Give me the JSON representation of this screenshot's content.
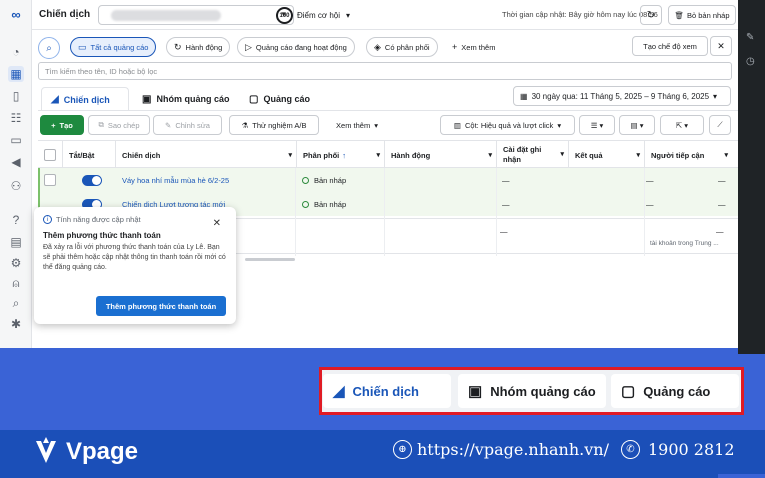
{
  "header": {
    "title": "Chiến dịch",
    "score_value": "100",
    "score_label": "Điểm cơ hội",
    "update_text": "Thời gian cập nhật: Bây giờ hôm nay lúc 08:56",
    "discard_label": "Bỏ bản nháp"
  },
  "filters": {
    "chips": [
      "Tất cả quảng cáo",
      "Hành động",
      "Quảng cáo đang hoạt động",
      "Có phân phối"
    ],
    "more_label": "Xem thêm",
    "create_view": "Tạo chế độ xem",
    "search_placeholder": "Tìm kiếm theo tên, ID hoặc bộ lọc"
  },
  "level_tabs": [
    "Chiến dịch",
    "Nhóm quảng cáo",
    "Quảng cáo"
  ],
  "date_range": "30 ngày qua: 11 Tháng 5, 2025 – 9 Tháng 6, 2025",
  "toolbar": {
    "create": "Tạo",
    "duplicate": "Sao chép",
    "edit": "Chỉnh sửa",
    "ab_test": "Thử nghiệm A/B",
    "more": "Xem thêm",
    "columns": "Cột: Hiệu quả và lượt click"
  },
  "table": {
    "columns": [
      "Tắt/Bật",
      "Chiến dịch",
      "Phân phối",
      "Hành động",
      "Cài đặt ghi nhận",
      "Kết quả",
      "Người tiếp cận"
    ],
    "rows": [
      {
        "name": "Váy hoa nhí mẫu mùa hè 6/2-25",
        "delivery": "Bản nháp",
        "dash": "—"
      },
      {
        "name": "Chiến dịch Lượt tương tác mới",
        "delivery": "Bản nháp",
        "dash": "—"
      },
      {
        "name": "",
        "delivery": "",
        "dash": "—"
      }
    ],
    "total_note": "tài khoản trong Trung ..."
  },
  "popup": {
    "badge": "Tính năng được cập nhật",
    "title": "Thêm phương thức thanh toán",
    "body": "Đã xảy ra lỗi với phương thức thanh toán của Ly Lê. Bạn sẽ phải thêm hoặc cập nhật thông tin thanh toán rồi mới có thể đăng quảng cáo.",
    "button": "Thêm phương thức thanh toán"
  },
  "zoom_tabs": [
    "Chiến dịch",
    "Nhóm quảng cáo",
    "Quảng cáo"
  ],
  "footer": {
    "brand": "Vpage",
    "website": "https://vpage.nhanh.vn/",
    "phone": "1900 2812"
  },
  "colors": {
    "accent": "#1a56b8",
    "create_green": "#1e8a3f",
    "banner_blue": "#3a63d6",
    "footer_blue": "#1b4fb8",
    "highlight_red": "#e01b24"
  }
}
